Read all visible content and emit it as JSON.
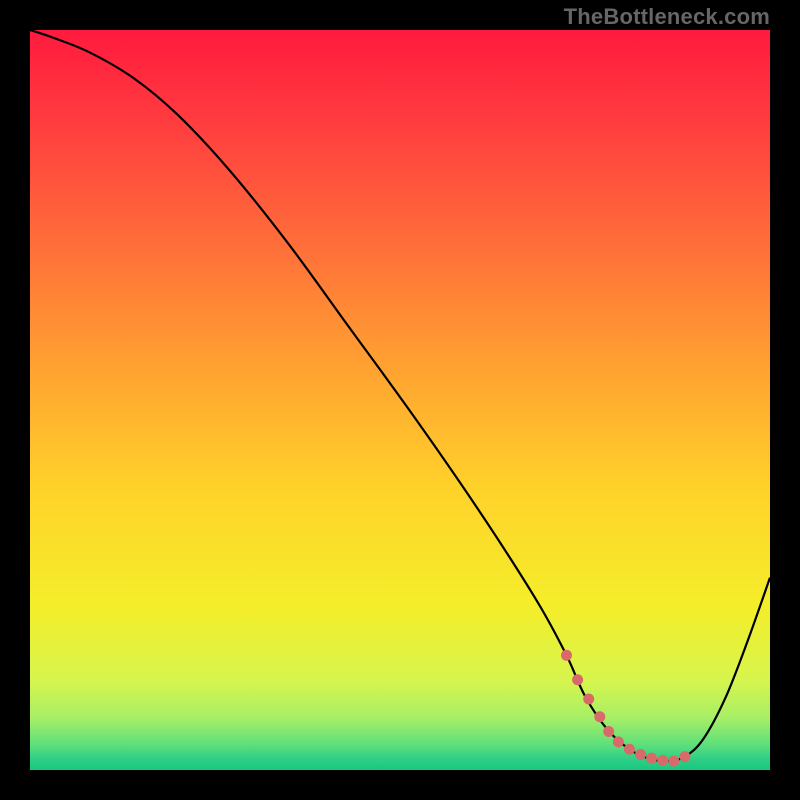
{
  "watermark": "TheBottleneck.com",
  "chart_data": {
    "type": "line",
    "title": "",
    "xlabel": "",
    "ylabel": "",
    "xlim": [
      0,
      100
    ],
    "ylim": [
      0,
      100
    ],
    "background_gradient": {
      "stops": [
        {
          "offset": 0.0,
          "color": "#ff1a3e"
        },
        {
          "offset": 0.12,
          "color": "#ff3b3f"
        },
        {
          "offset": 0.28,
          "color": "#ff6b3a"
        },
        {
          "offset": 0.45,
          "color": "#ffa031"
        },
        {
          "offset": 0.62,
          "color": "#ffd22a"
        },
        {
          "offset": 0.78,
          "color": "#f4ee2a"
        },
        {
          "offset": 0.88,
          "color": "#d6f54e"
        },
        {
          "offset": 0.93,
          "color": "#a6ef66"
        },
        {
          "offset": 0.965,
          "color": "#5fe07a"
        },
        {
          "offset": 0.985,
          "color": "#2fcf86"
        },
        {
          "offset": 1.0,
          "color": "#18c77f"
        }
      ]
    },
    "series": [
      {
        "name": "bottleneck-curve",
        "color": "#000000",
        "stroke_width": 2.2,
        "x": [
          0,
          3,
          8,
          14,
          20,
          27,
          35,
          43,
          51,
          58,
          64,
          69,
          72.5,
          75,
          78,
          81,
          83.5,
          86,
          88.5,
          91,
          94,
          97,
          100
        ],
        "y": [
          100,
          99,
          97,
          93.5,
          88.5,
          81,
          71,
          60,
          49,
          39,
          30,
          22,
          15.5,
          10,
          5.5,
          2.8,
          1.6,
          1.2,
          1.8,
          4.2,
          9.8,
          17.5,
          26
        ]
      }
    ],
    "markers": {
      "name": "valley-dots",
      "color": "#d86a6a",
      "radius": 5.5,
      "x": [
        72.5,
        74,
        75.5,
        77,
        78.2,
        79.5,
        81,
        82.5,
        84,
        85.5,
        87,
        88.5
      ],
      "y": [
        15.5,
        12.2,
        9.6,
        7.2,
        5.2,
        3.8,
        2.8,
        2.1,
        1.6,
        1.3,
        1.2,
        1.8
      ]
    }
  }
}
